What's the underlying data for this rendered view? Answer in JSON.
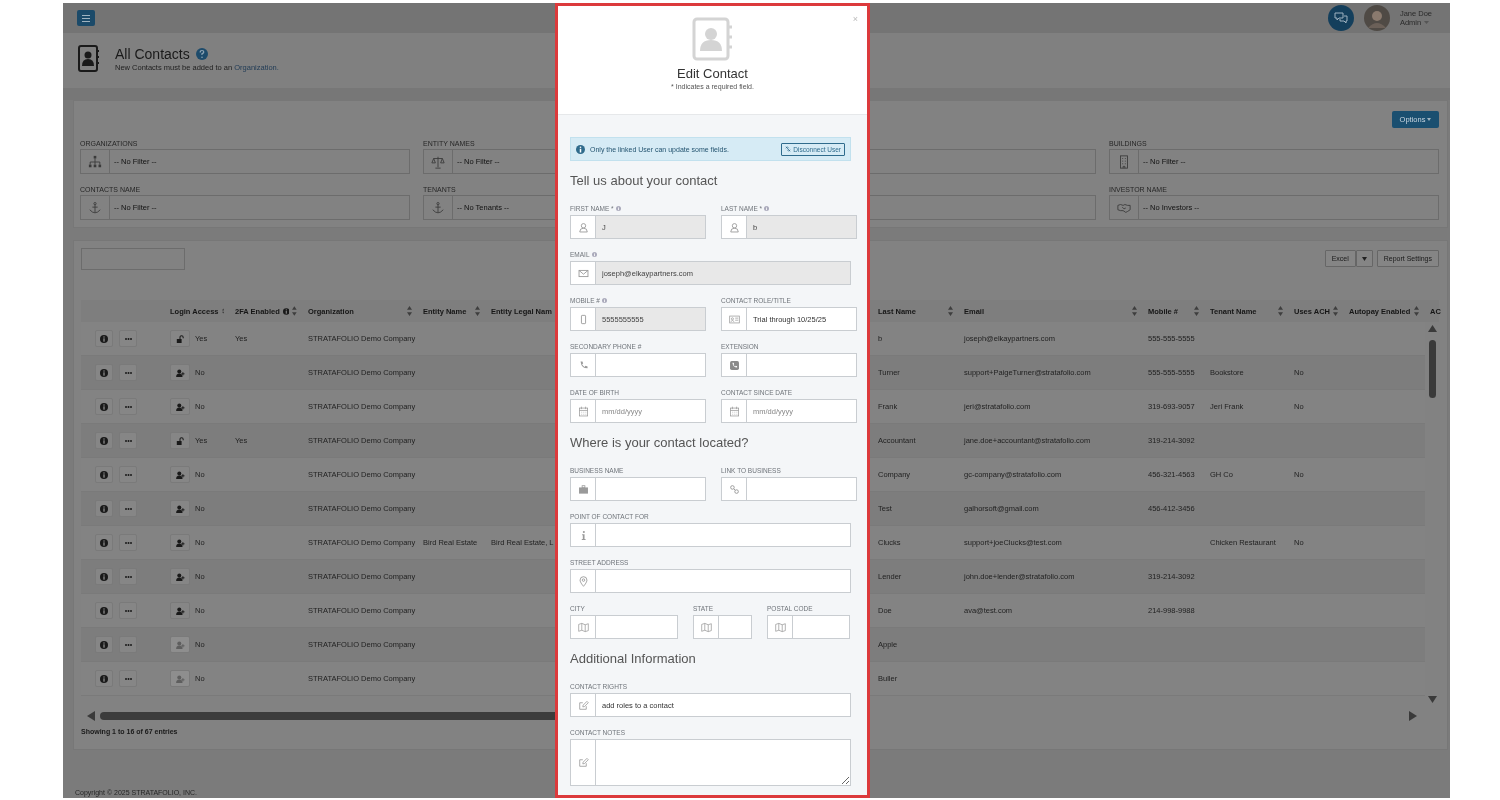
{
  "topbar": {
    "user": {
      "name": "Jane Doe",
      "role": "Admin"
    }
  },
  "page": {
    "title": "All Contacts",
    "subtitle": "New Contacts must be added to an ",
    "subtitle_link": "Organization."
  },
  "options_button": "Options",
  "filter_rows": [
    [
      {
        "label": "ORGANIZATIONS",
        "value": "-- No Filter --",
        "kind": "organization"
      },
      {
        "label": "ENTITY NAMES",
        "value": "-- No Filter --",
        "kind": "entity"
      },
      {
        "label": "BUILDINGS",
        "value": "-- No Filter --",
        "kind": "building"
      }
    ],
    [
      {
        "label": "CONTACTS NAME",
        "value": "-- No Filter --",
        "kind": "contact"
      },
      {
        "label": "TENANTS",
        "value": "-- No Tenants --",
        "kind": "tenant"
      },
      {
        "label": "INVESTOR NAME",
        "value": "-- No Investors --",
        "kind": "investor"
      }
    ]
  ],
  "table": {
    "export_buttons": [
      "Excel",
      "Report Settings"
    ],
    "columns": [
      {
        "label": "Login Access",
        "info": false,
        "sortable": true
      },
      {
        "label": "2FA Enabled",
        "info": true,
        "sortable": true
      },
      {
        "label": "Organization",
        "info": false,
        "sortable": true
      },
      {
        "label": "Entity Name",
        "info": false,
        "sortable": true
      },
      {
        "label": "Entity Legal Nam"
      },
      {
        "label": "Last Name",
        "info": false,
        "sortable": true
      },
      {
        "label": "Email",
        "info": false,
        "sortable": true
      },
      {
        "label": "Mobile #",
        "info": false,
        "sortable": true
      },
      {
        "label": "Tenant Name",
        "info": false,
        "sortable": true
      },
      {
        "label": "Uses ACH",
        "info": false,
        "sortable": true
      },
      {
        "label": "Autopay Enabled",
        "info": false,
        "sortable": true
      },
      {
        "label": "AC"
      }
    ],
    "rows": [
      {
        "has_login": true,
        "invite_disabled": false,
        "login": "Yes",
        "twofa": "Yes",
        "organization": "STRATAFOLIO Demo Company",
        "last_name": "b",
        "email": "joseph@elkaypartners.com",
        "mobile": "555-555-5555"
      },
      {
        "has_login": false,
        "invite_disabled": false,
        "login": "No",
        "organization": "STRATAFOLIO Demo Company",
        "last_name": "Turner",
        "email": "support+PaigeTurner@stratafolio.com",
        "mobile": "555-555-5555",
        "tenant": "Bookstore",
        "uses_ach": "No"
      },
      {
        "has_login": false,
        "invite_disabled": false,
        "login": "No",
        "organization": "STRATAFOLIO Demo Company",
        "last_name": "Frank",
        "email": "jeri@stratafolio.com",
        "mobile": "319-693-9057",
        "tenant": "Jeri Frank",
        "uses_ach": "No"
      },
      {
        "has_login": true,
        "invite_disabled": false,
        "login": "Yes",
        "twofa": "Yes",
        "organization": "STRATAFOLIO Demo Company",
        "last_name": "Accountant",
        "email": "jane.doe+accountant@stratafolio.com",
        "mobile": "319-214-3092"
      },
      {
        "has_login": false,
        "invite_disabled": false,
        "login": "No",
        "organization": "STRATAFOLIO Demo Company",
        "last_name": "Company",
        "email": "gc-company@stratafolio.com",
        "mobile": "456-321-4563",
        "tenant": "GH Co",
        "uses_ach": "No"
      },
      {
        "has_login": false,
        "invite_disabled": false,
        "login": "No",
        "organization": "STRATAFOLIO Demo Company",
        "last_name": "Test",
        "email": "galhorsoft@gmail.com",
        "mobile": "456-412-3456"
      },
      {
        "has_login": false,
        "invite_disabled": false,
        "login": "No",
        "organization": "STRATAFOLIO Demo Company",
        "entity_name": "Bird Real Estate",
        "entity_legal_name": "Bird Real Estate, L",
        "last_name": "Clucks",
        "email": "support+joeClucks@test.com",
        "tenant": "Chicken Restaurant",
        "uses_ach": "No"
      },
      {
        "has_login": false,
        "invite_disabled": false,
        "login": "No",
        "organization": "STRATAFOLIO Demo Company",
        "last_name": "Lender",
        "email": "john.doe+lender@stratafolio.com",
        "mobile": "319-214-3092"
      },
      {
        "has_login": false,
        "invite_disabled": false,
        "login": "No",
        "organization": "STRATAFOLIO Demo Company",
        "last_name": "Doe",
        "email": "ava@test.com",
        "mobile": "214-998-9988"
      },
      {
        "has_login": false,
        "invite_disabled": true,
        "login": "No",
        "organization": "STRATAFOLIO Demo Company",
        "last_name": "Apple"
      },
      {
        "has_login": false,
        "invite_disabled": true,
        "login": "No",
        "organization": "STRATAFOLIO Demo Company",
        "last_name": "Buller"
      }
    ],
    "footer": "Showing 1 to 16 of 67 entries"
  },
  "copyright": "Copyright © 2025 STRATAFOLIO, INC.",
  "modal": {
    "close": "×",
    "title": "Edit Contact",
    "note": "* Indicates a required field.",
    "alert": {
      "text": "Only the linked User can update some fields.",
      "button": "Disconnect User"
    },
    "sections": [
      {
        "heading": "Tell us about your contact",
        "rows": [
          [
            {
              "label": "FIRST NAME *",
              "info": true,
              "value": "J",
              "disabled": true,
              "kind": "person"
            },
            {
              "label": "LAST NAME *",
              "info": true,
              "value": "b",
              "disabled": true,
              "kind": "person"
            }
          ],
          [
            {
              "label": "EMAIL",
              "info": true,
              "value": "joseph@elkaypartners.com",
              "disabled": true,
              "kind": "email"
            }
          ],
          [
            {
              "label": "MOBILE #",
              "info": true,
              "value": "5555555555",
              "disabled": true,
              "kind": "mobile"
            },
            {
              "label": "CONTACT ROLE/TITLE",
              "info": false,
              "value": "Trial through 10/25/25",
              "disabled": false,
              "kind": "id-card"
            }
          ],
          [
            {
              "label": "SECONDARY PHONE #",
              "info": false,
              "disabled": false,
              "kind": "phone"
            },
            {
              "label": "EXTENSION",
              "info": false,
              "disabled": false,
              "kind": "extension"
            }
          ],
          [
            {
              "label": "DATE OF BIRTH",
              "info": false,
              "placeholder": "mm/dd/yyyy",
              "disabled": false,
              "kind": "date"
            },
            {
              "label": "CONTACT SINCE DATE",
              "info": false,
              "placeholder": "mm/dd/yyyy",
              "disabled": false,
              "kind": "date"
            }
          ]
        ]
      },
      {
        "heading": "Where is your contact located?",
        "rows": [
          [
            {
              "label": "BUSINESS NAME",
              "info": false,
              "disabled": false,
              "kind": "business"
            },
            {
              "label": "LINK TO BUSINESS",
              "info": false,
              "disabled": false,
              "kind": "link"
            }
          ],
          [
            {
              "label": "POINT OF CONTACT FOR",
              "info": false,
              "disabled": false,
              "kind": "info"
            }
          ],
          [
            {
              "label": "STREET ADDRESS",
              "info": false,
              "disabled": false,
              "kind": "location"
            }
          ],
          [
            {
              "label": "CITY",
              "info": false,
              "disabled": false,
              "kind": "map"
            },
            {
              "label": "STATE",
              "info": false,
              "disabled": false,
              "kind": "map"
            },
            {
              "label": "POSTAL CODE",
              "info": false,
              "disabled": false,
              "kind": "map"
            }
          ]
        ]
      },
      {
        "heading": "Additional Information",
        "rows": [
          [
            {
              "label": "CONTACT RIGHTS",
              "info": false,
              "value": "add roles to a contact",
              "disabled": false,
              "kind": "edit"
            }
          ],
          [
            {
              "label": "CONTACT NOTES",
              "info": false,
              "disabled": false,
              "kind": "notes"
            }
          ]
        ]
      }
    ]
  }
}
